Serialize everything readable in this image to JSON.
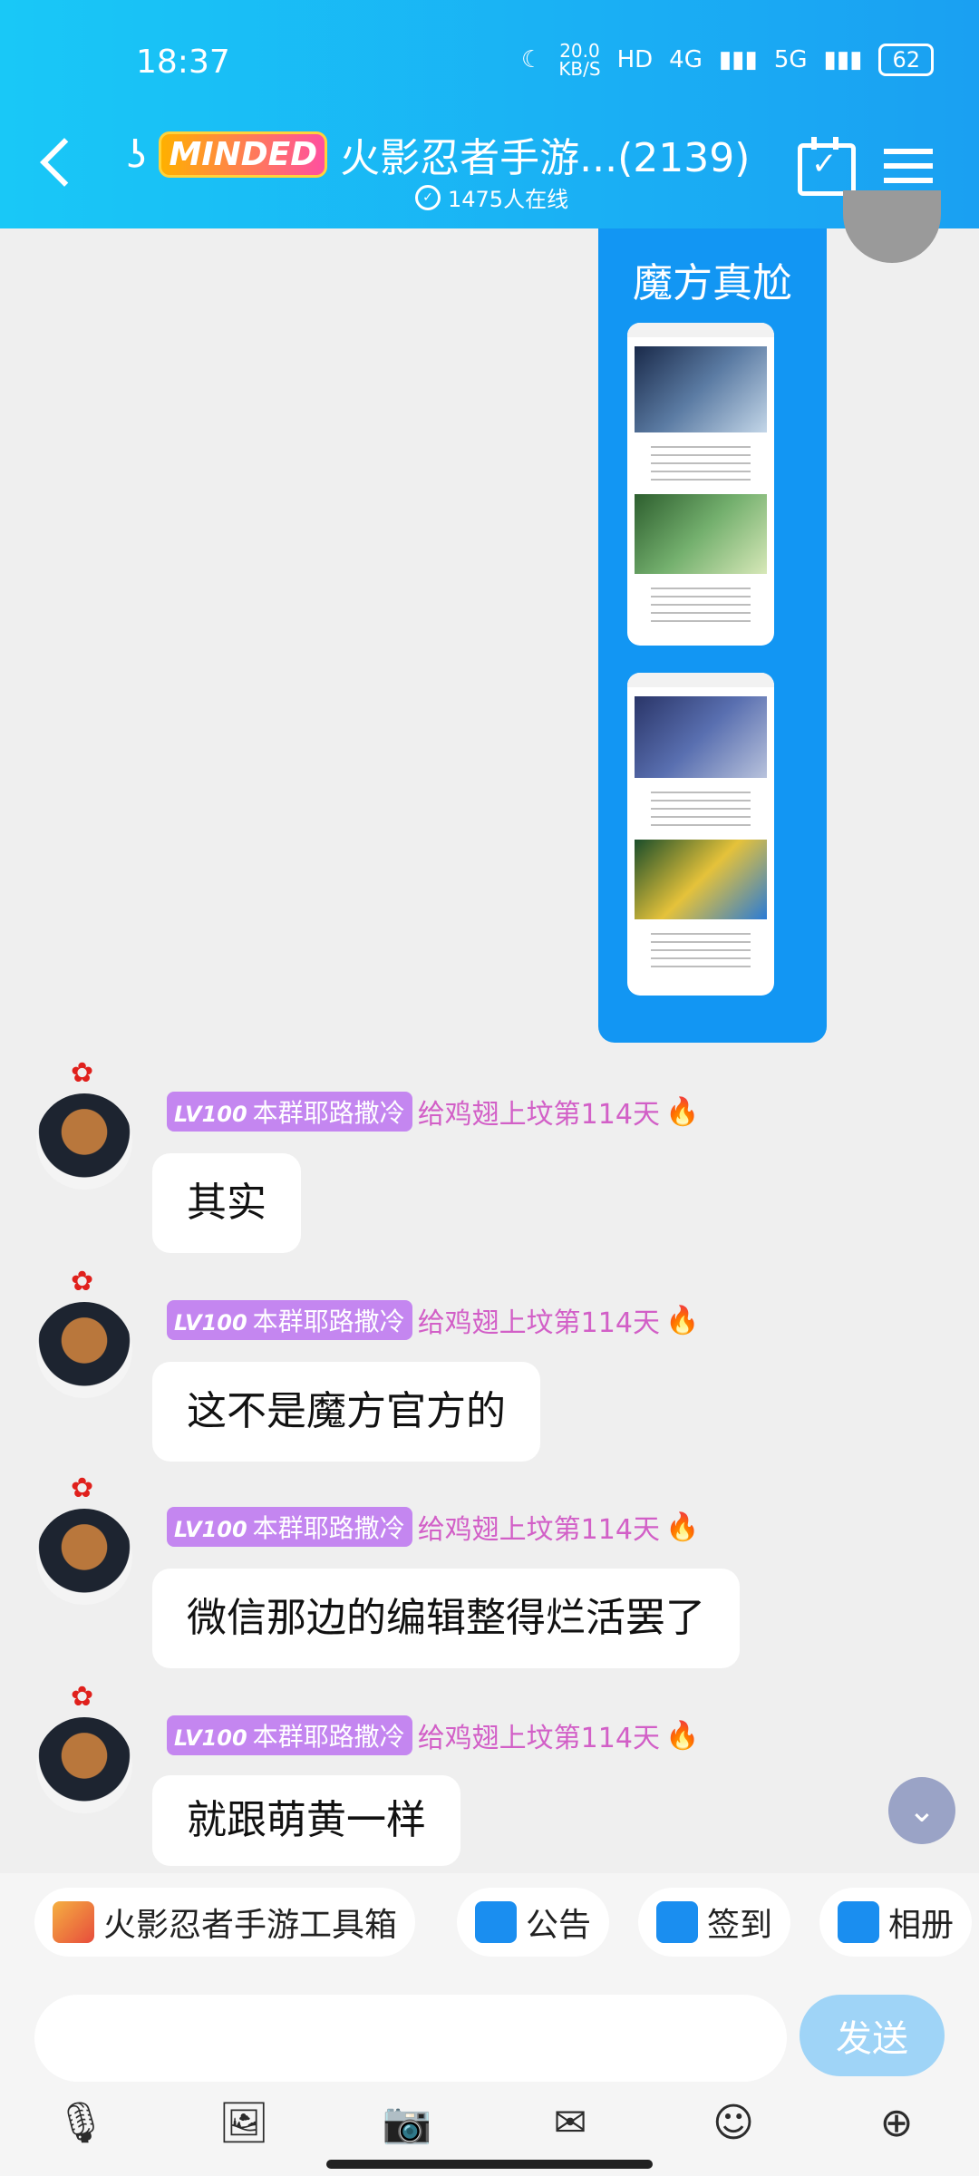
{
  "status": {
    "time": "18:37",
    "net_speed_value": "20.0",
    "net_speed_unit": "KB/S",
    "hd_badge": "HD",
    "net1": "4G",
    "net2": "5G",
    "battery": "62"
  },
  "header": {
    "logo_text": "MINDED",
    "title": "火影忍者手游...(2139)",
    "online_text": "1475人在线"
  },
  "messages": {
    "image_bubble_title": "魔方真尬",
    "sender_level": "LV100",
    "sender_name": "本群耶路撒冷",
    "sender_title": "给鸡翅上坟第114天",
    "m1": "其实",
    "m2": "这不是魔方官方的",
    "m3": "微信那边的编辑整得烂活罢了",
    "m4": "就跟萌黄一样"
  },
  "quickbar": {
    "toolbox": "火影忍者手游工具箱",
    "notice": "公告",
    "checkin": "签到",
    "album": "相册"
  },
  "input": {
    "placeholder": "",
    "send_label": "发送"
  },
  "colors": {
    "header_start": "#19c8f7",
    "header_end": "#1aa0f2",
    "bubble_blue": "#1296f3",
    "level_badge": "#c486f0",
    "title_pink": "#d25fc7"
  }
}
